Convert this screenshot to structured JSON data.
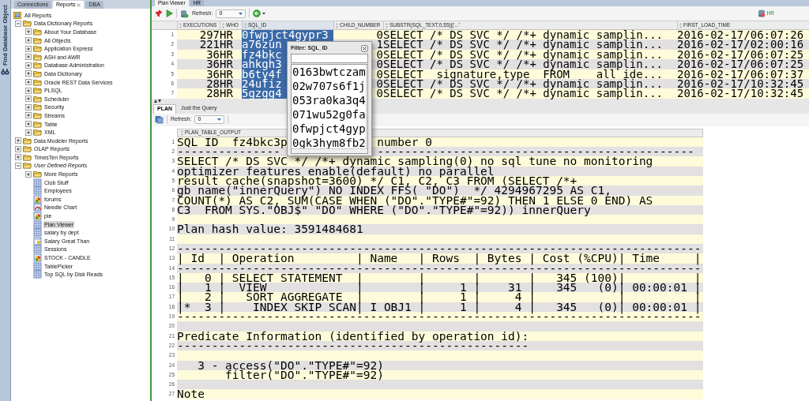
{
  "left_rail": {
    "label": "Find Database Object"
  },
  "navigator_tabs": [
    {
      "label": "Connections",
      "selected": false,
      "closable": false
    },
    {
      "label": "Reports",
      "selected": true,
      "closable": true
    },
    {
      "label": "DBA",
      "selected": false,
      "closable": false
    }
  ],
  "report_tree": [
    {
      "label": "All Reports",
      "kind": "root",
      "selected": false,
      "italic": false,
      "children": [
        {
          "label": "Data Dictionary Reports",
          "kind": "folder",
          "expanded": true,
          "selected": false,
          "italic": false,
          "children": [
            {
              "label": "About Your Database",
              "kind": "folder",
              "expanded": false,
              "selected": false,
              "italic": false
            },
            {
              "label": "All Objects",
              "kind": "folder",
              "expanded": false,
              "selected": false,
              "italic": false
            },
            {
              "label": "Application Express",
              "kind": "folder",
              "expanded": false,
              "selected": false,
              "italic": false
            },
            {
              "label": "ASH and AWR",
              "kind": "folder",
              "expanded": false,
              "selected": false,
              "italic": false
            },
            {
              "label": "Database Administration",
              "kind": "folder",
              "expanded": false,
              "selected": false,
              "italic": false
            },
            {
              "label": "Data Dictionary",
              "kind": "folder",
              "expanded": false,
              "selected": false,
              "italic": false
            },
            {
              "label": "Oracle REST Data Services",
              "kind": "folder",
              "expanded": false,
              "selected": false,
              "italic": false
            },
            {
              "label": "PLSQL",
              "kind": "folder",
              "expanded": false,
              "selected": false,
              "italic": false
            },
            {
              "label": "Scheduler",
              "kind": "folder",
              "expanded": false,
              "selected": false,
              "italic": false
            },
            {
              "label": "Security",
              "kind": "folder",
              "expanded": false,
              "selected": false,
              "italic": false
            },
            {
              "label": "Streams",
              "kind": "folder",
              "expanded": false,
              "selected": false,
              "italic": false
            },
            {
              "label": "Table",
              "kind": "folder",
              "expanded": false,
              "selected": false,
              "italic": false
            },
            {
              "label": "XML",
              "kind": "folder",
              "expanded": false,
              "selected": false,
              "italic": false
            }
          ]
        },
        {
          "label": "Data Modeler Reports",
          "kind": "folder",
          "expanded": false,
          "selected": false,
          "italic": false
        },
        {
          "label": "OLAP Reports",
          "kind": "folder",
          "expanded": false,
          "selected": false,
          "italic": false
        },
        {
          "label": "TimesTen Reports",
          "kind": "folder",
          "expanded": false,
          "selected": false,
          "italic": false
        },
        {
          "label": "User Defined Reports",
          "kind": "folder",
          "expanded": true,
          "selected": false,
          "italic": true,
          "children": [
            {
              "label": "More Reports",
              "kind": "folder",
              "expanded": false,
              "selected": false,
              "italic": false
            },
            {
              "label": "Clob Stuff",
              "kind": "table_report",
              "selected": false,
              "italic": false
            },
            {
              "label": "Employees",
              "kind": "table_report",
              "selected": false,
              "italic": false
            },
            {
              "label": "forums",
              "kind": "chart_report",
              "selected": false,
              "italic": false
            },
            {
              "label": "Needle Chart",
              "kind": "gauge_report",
              "selected": false,
              "italic": false
            },
            {
              "label": "pie",
              "kind": "chart_report",
              "selected": false,
              "italic": false
            },
            {
              "label": "Plan Viewer",
              "kind": "table_report",
              "selected": true,
              "italic": false
            },
            {
              "label": "salary by dept",
              "kind": "table_report",
              "selected": false,
              "italic": false
            },
            {
              "label": "Salary Great Than",
              "kind": "form_report",
              "selected": false,
              "italic": false
            },
            {
              "label": "Sessions",
              "kind": "table_report",
              "selected": false,
              "italic": false
            },
            {
              "label": "STOCK - CANDLE",
              "kind": "chart_report",
              "selected": false,
              "italic": false
            },
            {
              "label": "TablePicker",
              "kind": "table_report",
              "selected": false,
              "italic": false
            },
            {
              "label": "Top SQL by Disk Reads",
              "kind": "table_report",
              "selected": false,
              "italic": false
            }
          ]
        }
      ]
    }
  ],
  "editor_tabs": [
    {
      "label": "Plan Viewer",
      "selected": true
    },
    {
      "label": "HR",
      "selected": false
    }
  ],
  "toolbar": {
    "refresh_label": "Refresh:",
    "refresh_value": "0",
    "connection": "HR"
  },
  "grid": {
    "columns": [
      {
        "label": "EXECUTIONS",
        "selected": false
      },
      {
        "label": "WHO",
        "selected": false
      },
      {
        "label": "SQL_ID",
        "selected": true
      },
      {
        "label": "CHILD_NUMBER",
        "selected": false
      },
      {
        "label": "SUBSTR(SQL_TEXT,0,55)||'...'",
        "selected": false
      },
      {
        "label": "FIRST_LOAD_TIME",
        "selected": false
      }
    ],
    "rows": [
      {
        "n": "1",
        "cells": [
          "297",
          "HR",
          "0fwpjct4gypr3",
          "0",
          "SELECT /* DS SVC */ /*+ dynamic samplin...",
          "2016-02-17/06:07:26"
        ]
      },
      {
        "n": "2",
        "cells": [
          "221",
          "HR",
          "a76zun",
          "1",
          "SELECT /* DS SVC */ /*+ dynamic samplin...",
          "2016-02-17/02:00:16"
        ]
      },
      {
        "n": "3",
        "cells": [
          "36",
          "HR",
          "fz4bkc",
          "0",
          "SELECT /* DS SVC */ /*+ dynamic samplin...",
          "2016-02-17/06:07:25"
        ]
      },
      {
        "n": "4",
        "cells": [
          "36",
          "HR",
          "ahkgh3",
          "0",
          "SELECT /* DS SVC */ /*+ dynamic samplin...",
          "2016-02-17/06:07:25"
        ]
      },
      {
        "n": "5",
        "cells": [
          "36",
          "HR",
          "b6ty4f",
          "0",
          "SELECT  signature,type  FROM    all ide...",
          "2016-02-17/06:07:37"
        ]
      },
      {
        "n": "6",
        "cells": [
          "28",
          "HR",
          "24ufiz",
          "0",
          "SELECT /* DS SVC */ /*+ dynamic samplin...",
          "2016-02-17/10:32:45"
        ]
      },
      {
        "n": "7",
        "cells": [
          "28",
          "HR",
          "5gzgg4",
          "0",
          "SELECT /* DS SVC */ /*+ dynamic samplin...",
          "2016-02-17/10:32:45"
        ]
      }
    ]
  },
  "filter_popup": {
    "title": "Filter: SQL_ID",
    "items": [
      "0163bwtczam",
      "02w707s6f1j",
      "053ra0ka3q4",
      "071wu52g0fa",
      "0fwpjct4gyp",
      "0gk3hym8fb2"
    ]
  },
  "result_tabs": [
    {
      "label": "PLAN",
      "selected": true
    },
    {
      "label": "Just the Query",
      "selected": false
    }
  ],
  "plan_toolbar": {
    "refresh_label": "Refresh:",
    "refresh_value": "0"
  },
  "plan": {
    "column": "PLAN_TABLE_OUTPUT",
    "lines": [
      {
        "n": "1",
        "text": "SQL ID  fz4bkc3p",
        "tail": "number 0"
      },
      {
        "n": "2",
        "text": "---------------",
        "tail": "----------------------------------------------"
      },
      {
        "n": "3",
        "text": "SELECT /* DS SVC */ /*+ dynamic sampling(0) no sql tune no monitoring"
      },
      {
        "n": "4",
        "text": "optimizer features enable(default) no parallel"
      },
      {
        "n": "5",
        "text": "result cache(snapshot=3600) */ C1, C2, C3 FROM (SELECT /*+"
      },
      {
        "n": "6",
        "text": "gb name(\"innerQuery\") NO INDEX FFS( \"DO\")  */ 4294967295 AS C1,"
      },
      {
        "n": "7",
        "text": "COUNT(*) AS C2, SUM(CASE WHEN (\"DO\".\"TYPE#\"=92) THEN 1 ELSE 0 END) AS"
      },
      {
        "n": "8",
        "text": "C3  FROM SYS.\"OBJ$\" \"DO\" WHERE (\"DO\".\"TYPE#\"=92)) innerQuery"
      },
      {
        "n": "9"
      },
      {
        "n": "10",
        "text": "Plan hash value: 3591484681"
      },
      {
        "n": "11"
      },
      {
        "n": "12",
        "text": "----------------------------------------------------------------------------"
      },
      {
        "n": "13",
        "text": "| Id  | Operation         | Name   | Rows  | Bytes | Cost (%CPU)| Time     |"
      },
      {
        "n": "14",
        "text": "----------------------------------------------------------------------------"
      },
      {
        "n": "15",
        "text": "|   0 | SELECT STATEMENT  |        |       |       |   345 (100)|          |"
      },
      {
        "n": "16",
        "text": "|   1 |  VIEW             |        |     1 |    31 |   345   (0)| 00:00:01 |"
      },
      {
        "n": "17",
        "text": "|   2 |   SORT AGGREGATE  |        |     1 |     4 |            |          |"
      },
      {
        "n": "18",
        "text": "|*  3 |    INDEX SKIP SCAN| I OBJ1 |     1 |     4 |   345   (0)| 00:00:01 |"
      },
      {
        "n": "19",
        "text": "----------------------------------------------------------------------------"
      },
      {
        "n": "20"
      },
      {
        "n": "21",
        "text": "Predicate Information (identified by operation id):"
      },
      {
        "n": "22",
        "text": "---------------------------------------------------"
      },
      {
        "n": "23"
      },
      {
        "n": "24",
        "text": "   3 - access(\"DO\".\"TYPE#\"=92)"
      },
      {
        "n": "25",
        "text": "       filter(\"DO\".\"TYPE#\"=92)"
      },
      {
        "n": "26"
      },
      {
        "n": "27",
        "text": "Note"
      }
    ]
  }
}
